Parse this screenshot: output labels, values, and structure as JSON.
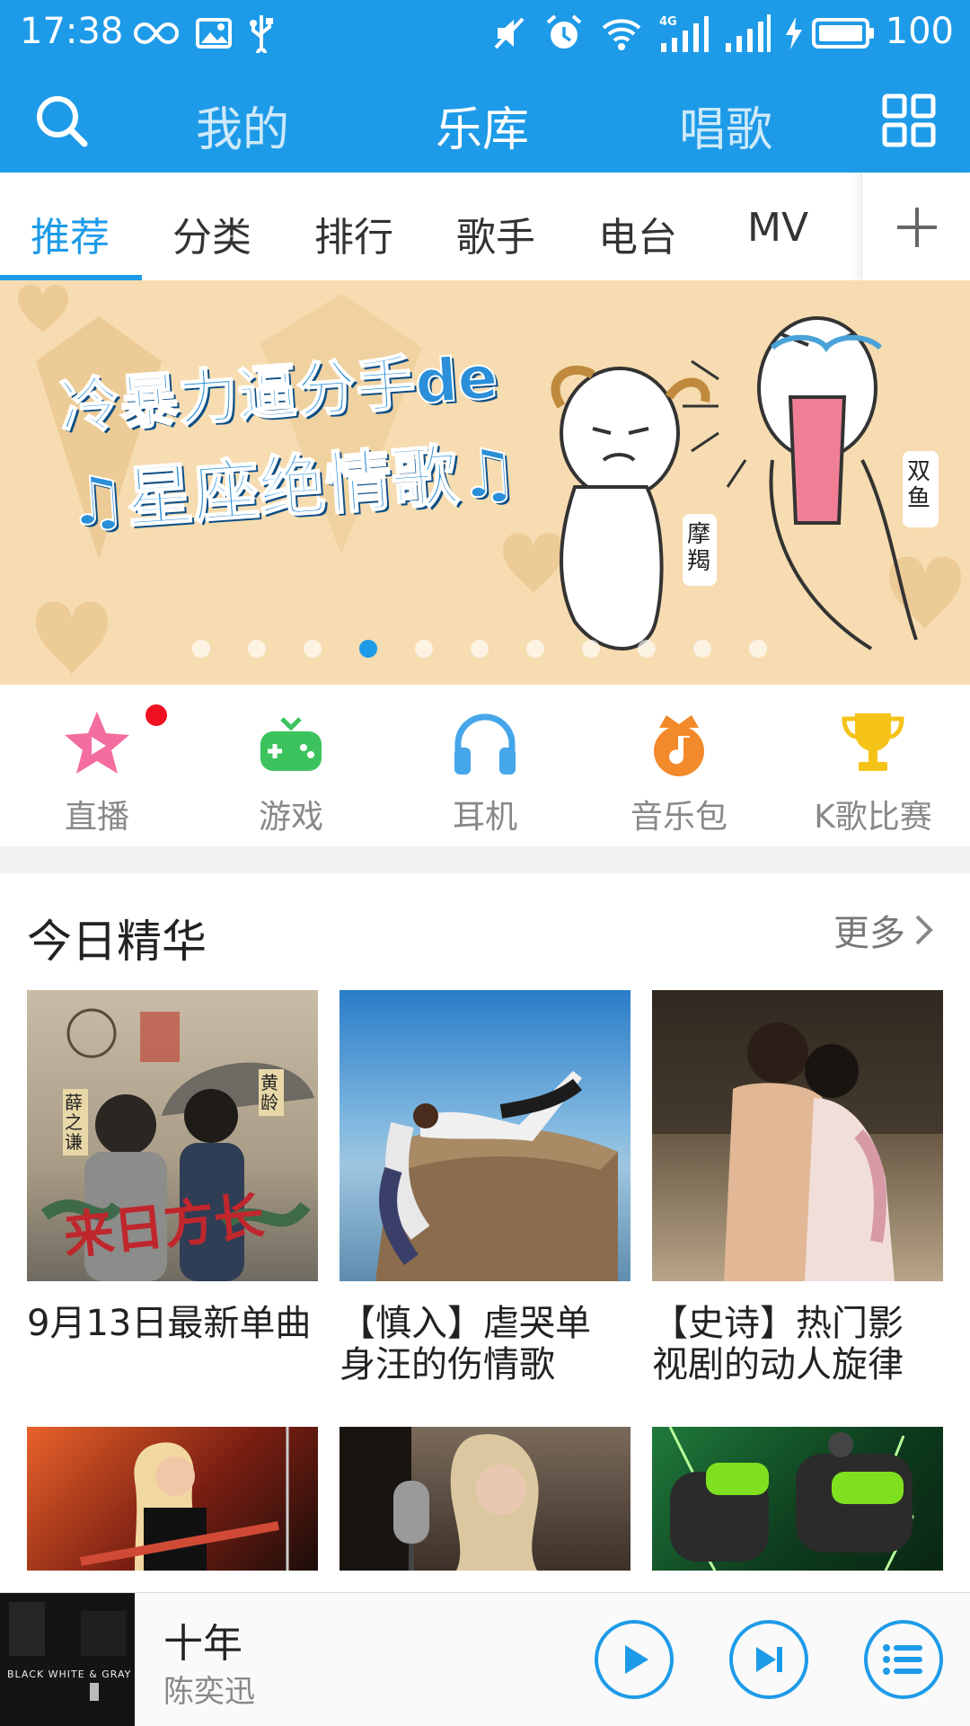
{
  "status_bar": {
    "time": "17:38",
    "battery": "100",
    "network_label": "4G"
  },
  "nav": {
    "tabs": [
      {
        "label": "我的"
      },
      {
        "label": "乐库"
      },
      {
        "label": "唱歌"
      }
    ],
    "active_index": 1
  },
  "sub_tabs": {
    "items": [
      {
        "label": "推荐"
      },
      {
        "label": "分类"
      },
      {
        "label": "排行"
      },
      {
        "label": "歌手"
      },
      {
        "label": "电台"
      },
      {
        "label": "MV"
      }
    ],
    "active_index": 0
  },
  "banner": {
    "headline_1": "冷暴力逼分手de",
    "headline_2": "♫星座绝情歌♫",
    "tag_capricorn": "摩羯",
    "tag_pisces": "双鱼",
    "dot_count": 11,
    "active_dot": 3
  },
  "quick_links": [
    {
      "label": "直播",
      "icon": "star-play-icon",
      "color": "#f36da0",
      "badge": true
    },
    {
      "label": "游戏",
      "icon": "gamepad-icon",
      "color": "#3cc35e",
      "badge": false
    },
    {
      "label": "耳机",
      "icon": "headphones-icon",
      "color": "#45a6ea",
      "badge": false
    },
    {
      "label": "音乐包",
      "icon": "music-pack-icon",
      "color": "#f2892a",
      "badge": false
    },
    {
      "label": "K歌比赛",
      "icon": "trophy-icon",
      "color": "#f5c318",
      "badge": false
    }
  ],
  "section": {
    "title": "今日精华",
    "more_label": "更多",
    "cards": [
      {
        "title_line1": "9月13日最新单曲",
        "title_line2": "",
        "thumb_text": "来日方长",
        "thumb_tag_left": "薛之谦",
        "thumb_tag_right": "黄龄"
      },
      {
        "title_line1": "【慎入】虐哭单",
        "title_line2": "身汪的伤情歌"
      },
      {
        "title_line1": "【史诗】热门影",
        "title_line2": "视剧的动人旋律"
      }
    ]
  },
  "player": {
    "song": "十年",
    "artist": "陈奕迅",
    "cover_text": "BLACK WHITE & GRAY"
  },
  "colors": {
    "primary": "#1e9be8",
    "badge_red": "#ee1122"
  }
}
